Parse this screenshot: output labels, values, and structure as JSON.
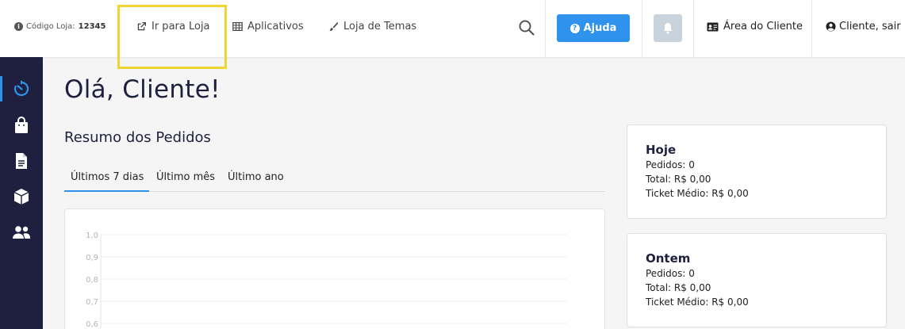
{
  "topbar": {
    "store_code_label": "Código Loja:",
    "store_code_value": "12345",
    "nav": {
      "go_to_store": "Ir para Loja",
      "apps": "Aplicativos",
      "theme_store": "Loja de Temas"
    },
    "help_label": "Ajuda",
    "client_area_label": "Área do Cliente",
    "logout_label": "Cliente, sair",
    "help_color": "#2f93ee",
    "highlight_color": "#f1d331"
  },
  "sidebar": {
    "items": [
      {
        "icon": "dashboard-icon",
        "active": true
      },
      {
        "icon": "shopping-bag-icon",
        "active": false
      },
      {
        "icon": "document-icon",
        "active": false
      },
      {
        "icon": "box-icon",
        "active": false
      },
      {
        "icon": "users-icon",
        "active": false
      }
    ],
    "background": "#1f2040"
  },
  "main": {
    "greeting": "Olá, Cliente!",
    "orders_summary_title": "Resumo dos Pedidos",
    "tabs": [
      {
        "label": "Últimos 7 dias",
        "active": true
      },
      {
        "label": "Último mês",
        "active": false
      },
      {
        "label": "Último ano",
        "active": false
      }
    ]
  },
  "chart_data": {
    "type": "line",
    "title": "",
    "xlabel": "",
    "ylabel": "",
    "ylim": [
      0,
      1.0
    ],
    "ytick_labels": [
      "1,0",
      "0,9",
      "0,8",
      "0,7",
      "0,6"
    ],
    "series": [],
    "grid": true
  },
  "summary_cards": [
    {
      "title": "Hoje",
      "orders": "Pedidos: 0",
      "total": "Total: R$ 0,00",
      "avg_ticket": "Ticket Médio: R$ 0,00"
    },
    {
      "title": "Ontem",
      "orders": "Pedidos: 0",
      "total": "Total: R$ 0,00",
      "avg_ticket": "Ticket Médio: R$ 0,00"
    }
  ]
}
